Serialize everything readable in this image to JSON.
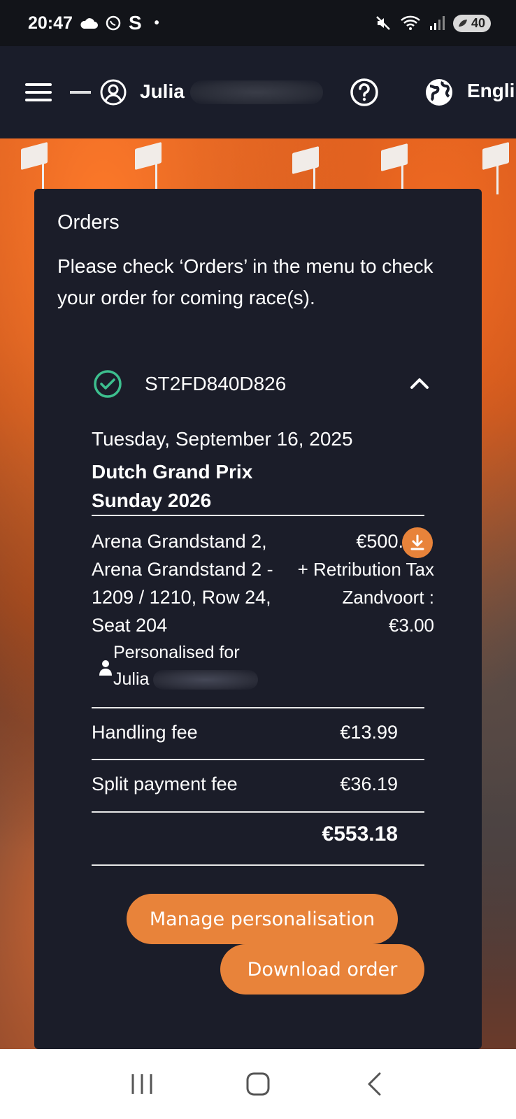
{
  "status_bar": {
    "time": "20:47",
    "battery": "40"
  },
  "header": {
    "user_name": "Julia",
    "language_label": "Engli"
  },
  "orders": {
    "title": "Orders",
    "intro": "Please check ‘Orders’ in the menu to check your order for coming race(s).",
    "order_id": "ST2FD840D826",
    "date": "Tuesday, September 16, 2025",
    "event_line1": "Dutch Grand Prix",
    "event_line2": "Sunday 2026",
    "ticket": {
      "description": "Arena Grandstand 2, Arena Grandstand 2 - 1209 / 1210, Row 24, Seat 204",
      "price": "€500.00",
      "tax_label": "+ Retribution Tax Zandvoort :",
      "tax_value": "€3.00",
      "personalised_label": "Personalised for",
      "personalised_name": "Julia"
    },
    "handling_fee_label": "Handling fee",
    "handling_fee_value": "€13.99",
    "split_fee_label": "Split payment fee",
    "split_fee_value": "€36.19",
    "total": "€553.18",
    "manage_button": "Manage personalisation",
    "download_button": "Download order"
  },
  "colors": {
    "accent": "#e8833a",
    "card_bg": "#1b1d29",
    "check_green": "#3dbf8e"
  },
  "icons": [
    "menu-icon",
    "user-icon",
    "help-icon",
    "globe-icon",
    "check-circle-icon",
    "chevron-up-icon",
    "download-icon",
    "person-icon",
    "recents-icon",
    "home-icon",
    "back-icon"
  ]
}
